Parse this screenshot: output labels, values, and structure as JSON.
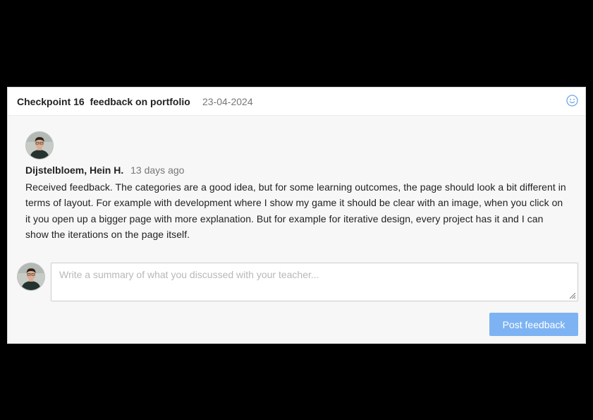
{
  "checkpoint": {
    "title": "Checkpoint 16  feedback on portfolio",
    "date": "23-04-2024",
    "reaction_icon": "smiley-icon"
  },
  "feedback": {
    "author": "Dijstelbloem, Hein H.",
    "time": "13 days ago",
    "text": "Received feedback. The categories are a good idea, but for some learning outcomes, the page should look a bit different in terms of layout. For example with development where I show my game it should be clear with an image, when you click on it you open up a bigger page with more explanation. But for example for iterative design, every project has it and I can show the iterations on the page itself."
  },
  "summary": {
    "placeholder": "Write a summary of what you discussed with your teacher...",
    "value": ""
  },
  "actions": {
    "post_label": "Post feedback"
  },
  "colors": {
    "accent_button": "#7db3f3",
    "smiley": "#6ea6e8",
    "muted_text": "#777777",
    "body_background": "#f7f7f7"
  }
}
